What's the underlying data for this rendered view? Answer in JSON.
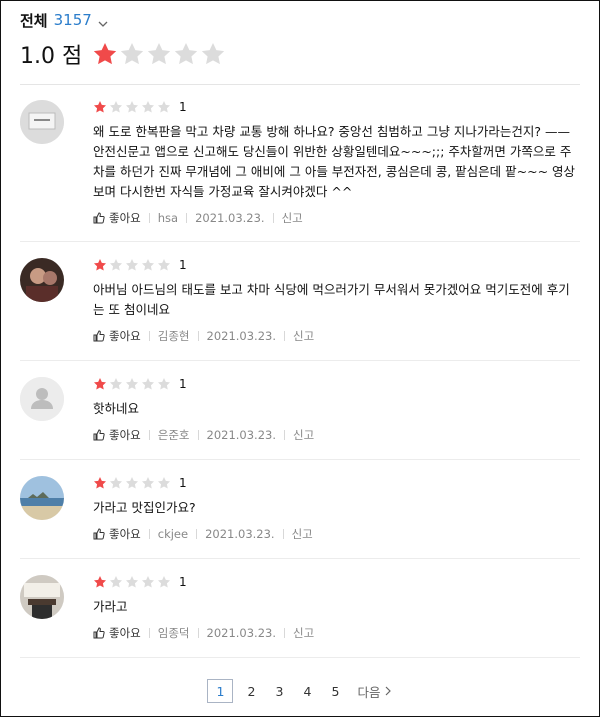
{
  "header": {
    "filter_label": "전체",
    "filter_count": "3157",
    "score_text": "1.0 점",
    "score_stars_filled": 1,
    "score_stars_total": 5
  },
  "colors": {
    "star_on": "#f04a4a",
    "star_off": "#dcdcdc",
    "link": "#2b7dcb"
  },
  "reviews": [
    {
      "avatar": "gray-card-avatar",
      "rating": "1",
      "text": "왜 도로 한복판을 막고 차량 교통 방해 하나요? 중앙선 침범하고 그냥 지나가라는건지? —— 안전신문고 앱으로 신고해도 당신들이 위반한 상황일텐데요~~~;;; 주차할꺼면 가쪽으로 주차를 하던가 진짜 무개념에 그 애비에 그 아들 부전자전, 콩심은데 콩, 팥심은데 팥~~~ 영상보며 다시한번 자식들 가정교육 잘시켜야겠다 ^^",
      "like_label": "좋아요",
      "user": "hsa",
      "date": "2021.03.23.",
      "report_label": "신고"
    },
    {
      "avatar": "photo-avatar",
      "rating": "1",
      "text": "아버님 아드님의 태도를 보고 차마 식당에 먹으러가기 무서워서 못가겠어요 먹기도전에 후기는 또 첨이네요",
      "like_label": "좋아요",
      "user": "김종현",
      "date": "2021.03.23.",
      "report_label": "신고"
    },
    {
      "avatar": "default-user-avatar",
      "rating": "1",
      "text": "핫하네요",
      "like_label": "좋아요",
      "user": "은준호",
      "date": "2021.03.23.",
      "report_label": "신고"
    },
    {
      "avatar": "beach-avatar",
      "rating": "1",
      "text": "가라고 맛집인가요?",
      "like_label": "좋아요",
      "user": "ckjee",
      "date": "2021.03.23.",
      "report_label": "신고"
    },
    {
      "avatar": "desk-avatar",
      "rating": "1",
      "text": "가라고",
      "like_label": "좋아요",
      "user": "임종덕",
      "date": "2021.03.23.",
      "report_label": "신고"
    }
  ],
  "pagination": {
    "pages": [
      "1",
      "2",
      "3",
      "4",
      "5"
    ],
    "current": "1",
    "next_label": "다음"
  }
}
